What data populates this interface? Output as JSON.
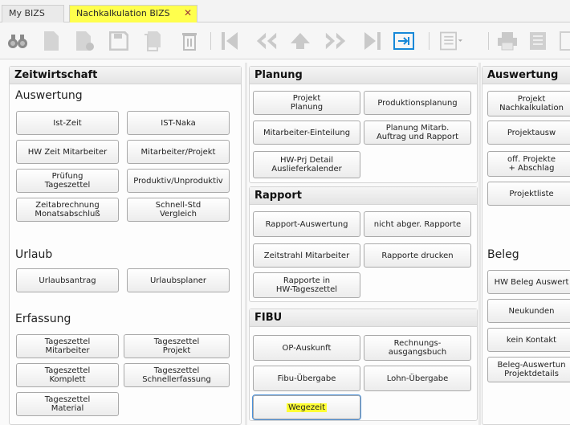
{
  "tabs": [
    {
      "label": "My BIZS"
    },
    {
      "label": "Nachkalkulation BIZS",
      "close": "✕"
    }
  ],
  "toolbar": {
    "icons": [
      "binoculars-icon",
      "new-document-icon",
      "add-document-icon",
      "save-icon",
      "copy-icon",
      "delete-icon",
      "first-record-icon",
      "previous-record-icon",
      "up-icon",
      "next-record-icon",
      "last-record-icon",
      "export-icon",
      "list-view-icon",
      "print-icon",
      "report-icon"
    ]
  },
  "zeitwirtschaft": {
    "title": "Zeitwirtschaft",
    "auswertung_label": "Auswertung",
    "urlaub_label": "Urlaub",
    "erfassung_label": "Erfassung",
    "buttons": {
      "ist_zeit": "Ist-Zeit",
      "ist_naka": "IST-Naka",
      "hw_zeit_mitarbeiter": "HW Zeit Mitarbeiter",
      "mitarbeiter_projekt": "Mitarbeiter/Projekt",
      "pruefung_tageszettel": "Prüfung\nTageszettel",
      "produktiv_unproduktiv": "Produktiv/Unproduktiv",
      "zeitabrechnung": "Zeitabrechnung\nMonatsabschluß",
      "schnell_std": "Schnell-Std\nVergleich",
      "urlaubsantrag": "Urlaubsantrag",
      "urlaubsplaner": "Urlaubsplaner",
      "tz_mitarbeiter": "Tageszettel\nMitarbeiter",
      "tz_projekt": "Tageszettel\nProjekt",
      "tz_komplett": "Tageszettel\nKomplett",
      "tz_schnell": "Tageszettel\nSchnellerfassung",
      "tz_material": "Tageszettel\nMaterial"
    }
  },
  "planung": {
    "title": "Planung",
    "buttons": {
      "projekt_planung": "Projekt\nPlanung",
      "produktionsplanung": "Produktionsplanung",
      "mitarbeiter_einteilung": "Mitarbeiter-Einteilung",
      "planung_mitarb": "Planung Mitarb.\nAuftrag und Rapport",
      "hw_prj_detail": "HW-Prj Detail\nAuslieferkalender"
    }
  },
  "rapport": {
    "title": "Rapport",
    "buttons": {
      "rapport_auswertung": "Rapport-Auswertung",
      "nicht_abger": "nicht abger. Rapporte",
      "zeitstrahl": "Zeitstrahl Mitarbeiter",
      "rapporte_drucken": "Rapporte drucken",
      "rapporte_hw": "Rapporte in\nHW-Tageszettel"
    }
  },
  "fibu": {
    "title": "FIBU",
    "buttons": {
      "op_auskunft": "OP-Auskunft",
      "rechnungsausgangsbuch": "Rechnungs-\nausgangsbuch",
      "fibu_uebergabe": "Fibu-Übergabe",
      "lohn_uebergabe": "Lohn-Übergabe",
      "wegezeit": "Wegezeit"
    }
  },
  "auswertung": {
    "title": "Auswertung",
    "beleg_label": "Beleg",
    "buttons": {
      "projekt_nachkalkulation": "Projekt\nNachkalkulation",
      "projektausw": "Projektausw",
      "off_projekte": "off. Projekte\n+ Abschlag",
      "projektliste": "Projektliste",
      "hw_beleg": "HW Beleg Auswert",
      "neukunden": "Neukunden",
      "kein_kontakt": "kein Kontakt",
      "beleg_auswertung": "Beleg-Auswertun\nProjektdetails"
    }
  }
}
